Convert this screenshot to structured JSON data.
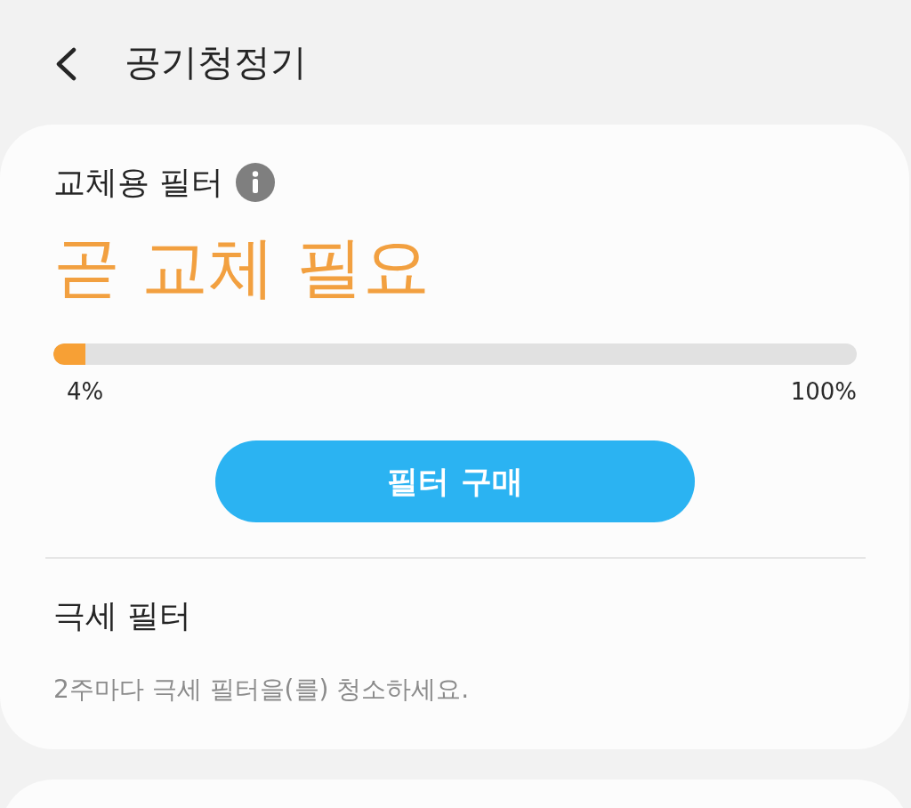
{
  "header": {
    "title": "공기청정기"
  },
  "filter_card": {
    "title": "교체용 필터",
    "status": "곧 교체 필요",
    "level": 0.04,
    "min_label": "4%",
    "max_label": "100%",
    "buy_button": "필터 구매"
  },
  "section": {
    "title": "극세 필터",
    "description": "2주마다 극세 필터을(를) 청소하세요."
  }
}
